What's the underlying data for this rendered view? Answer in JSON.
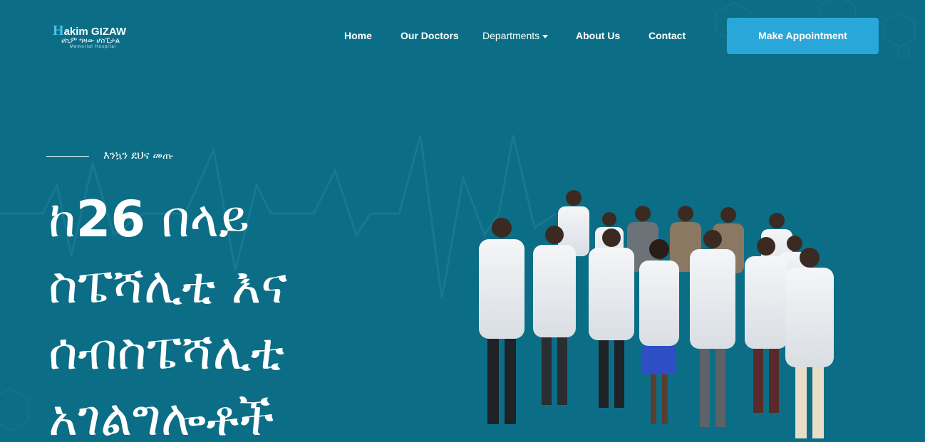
{
  "header": {
    "logo": {
      "initial": "H",
      "name": "akim GIZAW",
      "amharic": "ሀኪም ግዛው ሆስፒታል",
      "tagline": "Memorial Hospital"
    },
    "nav": [
      {
        "label": "Home"
      },
      {
        "label": "Our Doctors"
      },
      {
        "label": "Departments",
        "has_dropdown": true
      },
      {
        "label": "About Us"
      },
      {
        "label": "Contact"
      }
    ],
    "cta_label": "Make Appointment"
  },
  "hero": {
    "eyebrow": "እንኳን ደህና መጡ",
    "headline_lines": [
      {
        "prefix": "ከ",
        "number": "26",
        "suffix": " በላይ"
      },
      {
        "text": "ስፔሻሊቲ እና"
      },
      {
        "text": "ሰብስፔሻሊቲ"
      },
      {
        "text": "አገልግሎቶች"
      }
    ],
    "image_subject": "group-photo-of-doctors-in-white-coats"
  },
  "colors": {
    "background": "#0b6e86",
    "accent": "#2aa7d9",
    "logo_accent": "#49c3e6",
    "text": "#ffffff"
  }
}
